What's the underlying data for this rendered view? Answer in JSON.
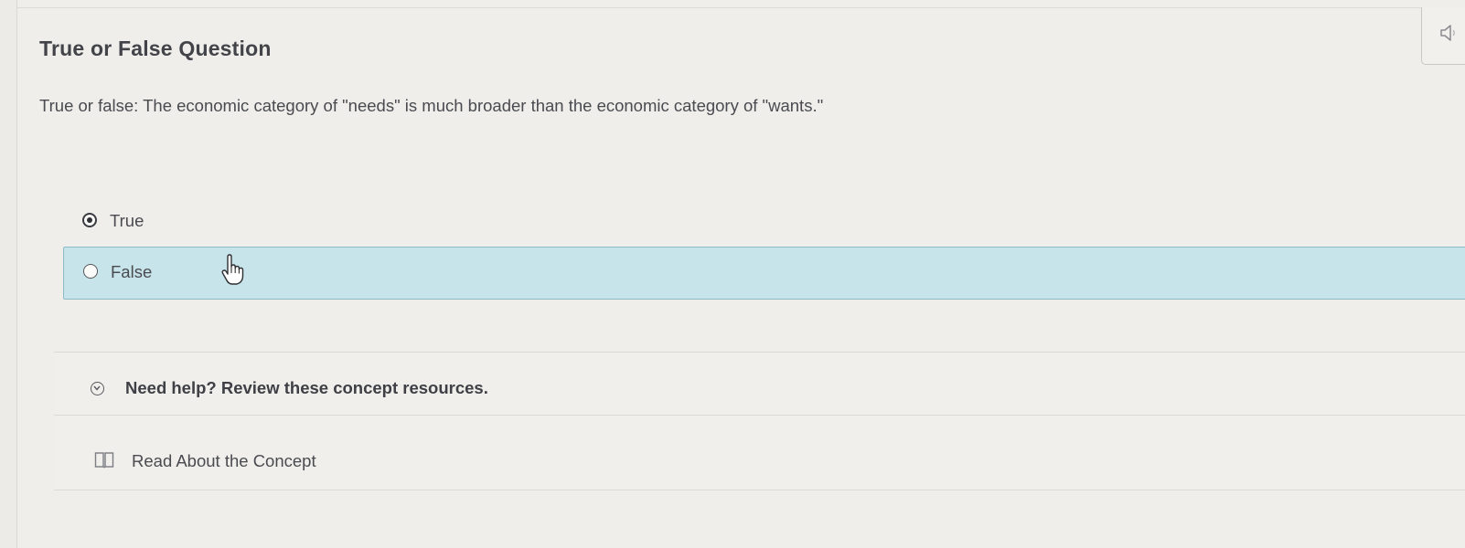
{
  "question_panel": {
    "title": "True or False Question",
    "prompt": "True or false: The economic category of \"needs\" is much broader than the economic category of \"wants.\"",
    "audio_icon": "speaker-icon"
  },
  "answer_options": [
    {
      "label": "True",
      "selected": true
    },
    {
      "label": "False",
      "selected": false,
      "highlighted": true
    }
  ],
  "help": {
    "title": "Need help? Review these concept resources.",
    "expand_icon": "chevron-down-circle-icon",
    "resources": [
      {
        "label": "Read About the Concept",
        "icon": "book-icon"
      }
    ]
  },
  "cursor_icon": "hand-pointer-icon",
  "colors": {
    "highlight_background": "#c7e4ea",
    "highlight_border": "#8dbcc8",
    "text": "#4a4b50"
  }
}
